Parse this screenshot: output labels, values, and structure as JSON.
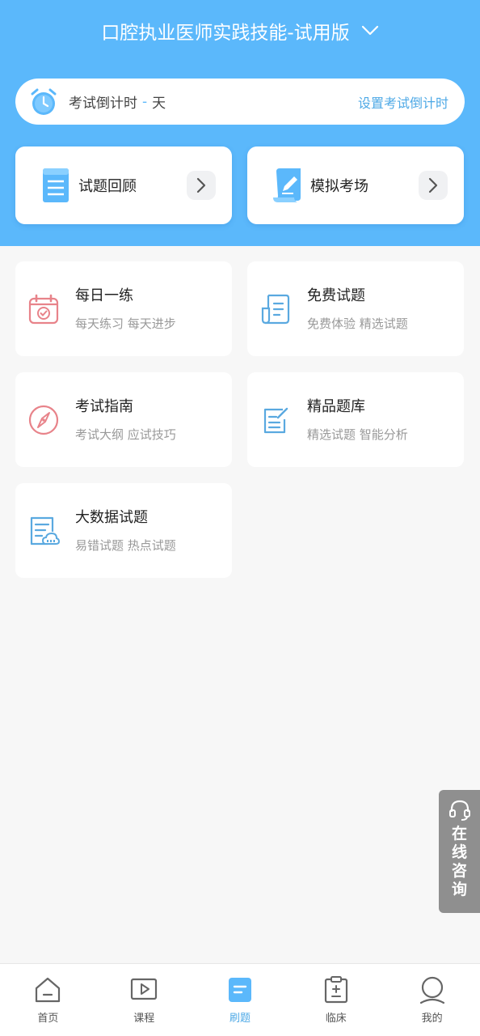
{
  "header": {
    "course_title": "口腔执业医师实践技能-试用版",
    "countdown_label": "考试倒计时",
    "countdown_value": "-",
    "countdown_unit": "天",
    "set_countdown": "设置考试倒计时"
  },
  "quick_actions": [
    {
      "label": "试题回顾",
      "icon": "list-document-icon"
    },
    {
      "label": "模拟考场",
      "icon": "pencil-paper-icon"
    }
  ],
  "features": [
    {
      "title": "每日一练",
      "subtitle": "每天练习 每天进步",
      "icon": "calendar-check-icon"
    },
    {
      "title": "免费试题",
      "subtitle": "免费体验 精选试题",
      "icon": "document-icon"
    },
    {
      "title": "考试指南",
      "subtitle": "考试大纲 应试技巧",
      "icon": "compass-icon"
    },
    {
      "title": "精品题库",
      "subtitle": "精选试题 智能分析",
      "icon": "edit-document-icon"
    },
    {
      "title": "大数据试题",
      "subtitle": "易错试题 热点试题",
      "icon": "cloud-document-icon"
    }
  ],
  "consult": {
    "label": "在线咨询",
    "icon": "headset-icon"
  },
  "bottom_nav": [
    {
      "label": "首页",
      "icon": "home-icon",
      "active": false
    },
    {
      "label": "课程",
      "icon": "video-icon",
      "active": false
    },
    {
      "label": "刷题",
      "icon": "practice-icon",
      "active": true
    },
    {
      "label": "临床",
      "icon": "clipboard-icon",
      "active": false
    },
    {
      "label": "我的",
      "icon": "user-icon",
      "active": false
    }
  ],
  "colors": {
    "primary": "#5bb8fb",
    "accent_text": "#4ea9e6",
    "icon_red": "#e8838a",
    "icon_blue": "#5aa9e0",
    "consult_bg": "#8f8f8f",
    "page_bg": "#f7f7f7"
  }
}
